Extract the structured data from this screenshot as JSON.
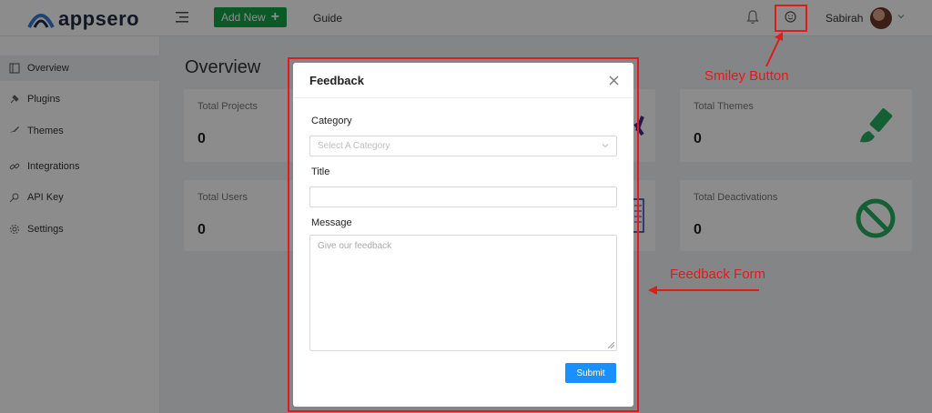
{
  "header": {
    "logo_text": "appsero",
    "add_new_label": "Add New",
    "guide_label": "Guide",
    "user_name": "Sabirah"
  },
  "sidebar": {
    "items": [
      {
        "label": "Overview",
        "icon": "overview-icon",
        "active": true
      },
      {
        "label": "Plugins",
        "icon": "plugin-icon"
      },
      {
        "label": "Themes",
        "icon": "brush-icon"
      },
      {
        "label": "Integrations",
        "icon": "link-icon"
      },
      {
        "label": "API Key",
        "icon": "key-icon"
      },
      {
        "label": "Settings",
        "icon": "gear-icon"
      }
    ]
  },
  "main": {
    "title": "Overview",
    "cards": [
      {
        "label": "Total Projects",
        "value": "0"
      },
      {
        "label": "Total Themes",
        "value": "0",
        "icon": "paintbrush-icon"
      },
      {
        "label": "Total Users",
        "value": "0"
      },
      {
        "label": "Total Deactivations",
        "value": "0",
        "icon": "prohibited-icon"
      }
    ]
  },
  "modal": {
    "title": "Feedback",
    "category_label": "Category",
    "category_placeholder": "Select A Category",
    "title_label": "Title",
    "title_value": "",
    "message_label": "Message",
    "message_placeholder": "Give our feedback",
    "submit_label": "Submit"
  },
  "annotations": {
    "smiley_label": "Smiley Button",
    "form_label": "Feedback Form",
    "color": "#e01b1b"
  },
  "colors": {
    "brand_green": "#16a34a",
    "primary_blue": "#1890ff",
    "icon_green": "#27ae60"
  }
}
